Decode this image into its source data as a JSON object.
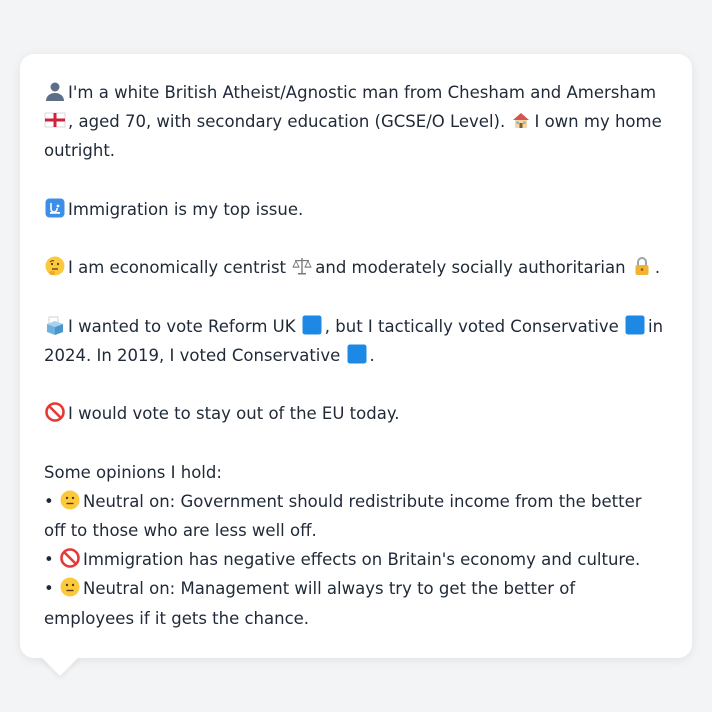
{
  "profile": {
    "intro": {
      "part1": "I'm a white British Atheist/Agnostic man from Chesham and Amersham",
      "part2": ", aged 70, with secondary education (GCSE/O Level).",
      "part3": "I own my home outright."
    },
    "top_issue": "Immigration is my top issue.",
    "ideology": {
      "part1": "I am economically centrist",
      "part2": "and moderately socially authoritarian",
      "part3": "."
    },
    "vote": {
      "part1": "I wanted to vote Reform UK",
      "part2": ", but I tactically voted Conservative",
      "part3": "in 2024. In 2019, I voted Conservative",
      "part4": "."
    },
    "eu": "I would vote to stay out of the EU today.",
    "opinions_heading": "Some opinions I hold:",
    "opinions": [
      {
        "bullet": "•",
        "text": "Neutral on: Government should redistribute income from the better off to those who are less well off."
      },
      {
        "bullet": "•",
        "text": "Immigration has negative effects on Britain's economy and culture."
      },
      {
        "bullet": "•",
        "text": "Neutral on: Management will always try to get the better of employees if it gets the chance."
      }
    ]
  },
  "colors": {
    "background": "#f3f4f6",
    "card": "#ffffff",
    "text": "#1f2937",
    "party_blue": "#1e88e5"
  },
  "icons": [
    "person-icon",
    "england-flag-icon",
    "house-icon",
    "passport-control-icon",
    "thinking-face-icon",
    "balance-scale-icon",
    "lock-icon",
    "ballot-box-icon",
    "blue-square-icon",
    "prohibited-icon",
    "neutral-face-icon"
  ]
}
